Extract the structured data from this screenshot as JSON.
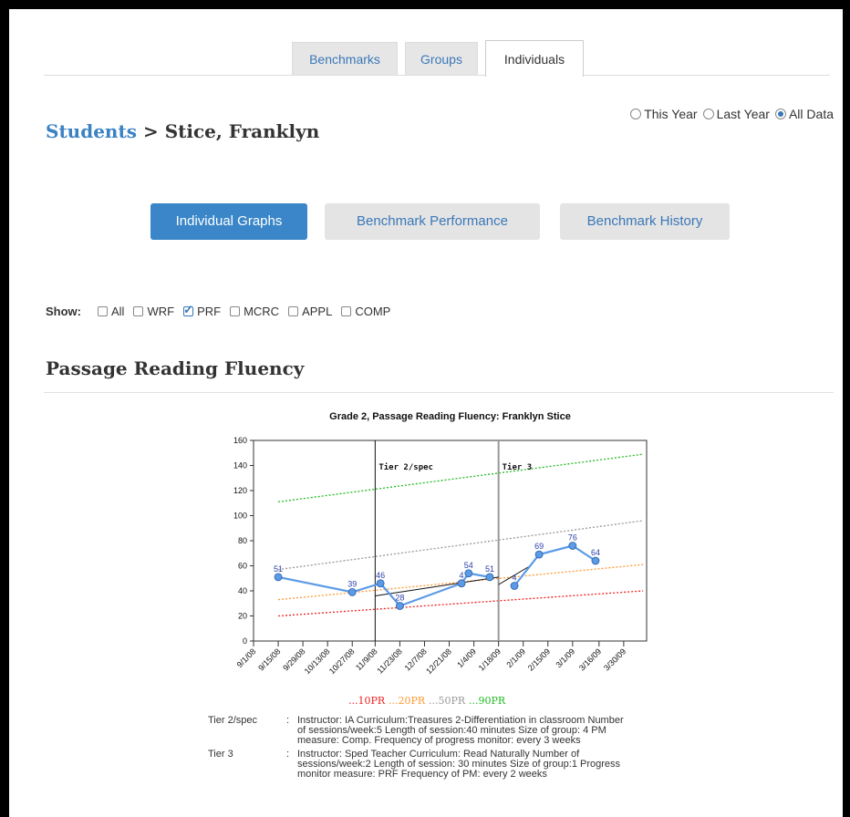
{
  "tabs": [
    {
      "label": "Benchmarks",
      "active": false
    },
    {
      "label": "Groups",
      "active": false
    },
    {
      "label": "Individuals",
      "active": true
    }
  ],
  "filters": {
    "this_year": "This Year",
    "last_year": "Last Year",
    "all_data": "All Data",
    "selected": "all_data"
  },
  "breadcrumb": {
    "parent": "Students",
    "separator": ">",
    "current": "Stice, Franklyn"
  },
  "view_buttons": [
    {
      "label": "Individual Graphs",
      "active": true
    },
    {
      "label": "Benchmark Performance",
      "active": false
    },
    {
      "label": "Benchmark History",
      "active": false
    }
  ],
  "show": {
    "label": "Show:",
    "options": [
      {
        "label": "All",
        "checked": false
      },
      {
        "label": "WRF",
        "checked": false
      },
      {
        "label": "PRF",
        "checked": true
      },
      {
        "label": "MCRC",
        "checked": false
      },
      {
        "label": "APPL",
        "checked": false
      },
      {
        "label": "COMP",
        "checked": false
      }
    ]
  },
  "section_title": "Passage Reading Fluency",
  "colors": {
    "accent": "#3a86c8",
    "link": "#3b82c4",
    "series": "#5b9be6",
    "pr10": "#ee2222",
    "pr20": "#ff9933",
    "pr50": "#999999",
    "pr90": "#22bb22"
  },
  "chart_data": {
    "type": "line",
    "title": "Grade 2, Passage Reading Fluency: Franklyn Stice",
    "x_ticks": [
      "9/1/08",
      "9/15/08",
      "9/29/08",
      "10/13/08",
      "10/27/08",
      "11/9/08",
      "11/23/08",
      "12/7/08",
      "12/21/08",
      "1/4/09",
      "1/18/09",
      "2/1/09",
      "2/15/09",
      "3/1/09",
      "3/16/09",
      "3/30/09"
    ],
    "ylim": [
      0,
      160
    ],
    "y_ticks": [
      0,
      20,
      40,
      60,
      80,
      100,
      120,
      140,
      160
    ],
    "series": [
      {
        "points": [
          {
            "x": "2008-09-15",
            "y": 51
          },
          {
            "x": "2008-10-27",
            "y": 39
          },
          {
            "x": "2008-11-12",
            "y": 46
          },
          {
            "x": "2008-11-23",
            "y": 28
          },
          {
            "x": "2008-12-28",
            "y": 46
          },
          {
            "x": "2009-01-01",
            "y": 54
          },
          {
            "x": "2009-01-13",
            "y": 51
          },
          {
            "x": "2009-01-27",
            "y": 44
          },
          {
            "x": "2009-02-10",
            "y": 69
          },
          {
            "x": "2009-03-01",
            "y": 76
          },
          {
            "x": "2009-03-14",
            "y": 64
          }
        ]
      }
    ],
    "point_labels": [
      "51",
      "39",
      "46",
      "28",
      "4",
      "54",
      "51",
      "4",
      "69",
      "76",
      "64"
    ],
    "benchmarks": [
      {
        "label": "10PR",
        "start": {
          "x": "2008-09-15",
          "y": 20
        },
        "end": {
          "x": "2009-04-10",
          "y": 40
        }
      },
      {
        "label": "20PR",
        "start": {
          "x": "2008-09-15",
          "y": 33
        },
        "end": {
          "x": "2009-04-10",
          "y": 61
        }
      },
      {
        "label": "50PR",
        "start": {
          "x": "2008-09-15",
          "y": 57
        },
        "end": {
          "x": "2009-04-10",
          "y": 96
        }
      },
      {
        "label": "90PR",
        "start": {
          "x": "2008-09-15",
          "y": 111
        },
        "end": {
          "x": "2009-04-10",
          "y": 149
        }
      }
    ],
    "legend_prefix": "...",
    "phases": [
      {
        "label": "Tier 2/spec",
        "x": "2008-11-09"
      },
      {
        "label": "Tier 3",
        "x": "2009-01-18"
      }
    ],
    "trend_lines": [
      {
        "start": {
          "x": "2008-11-09",
          "y": 36
        },
        "end": {
          "x": "2009-01-18",
          "y": 51
        }
      },
      {
        "start": {
          "x": "2009-01-18",
          "y": 45
        },
        "end": {
          "x": "2009-02-05",
          "y": 60
        }
      }
    ]
  },
  "notes": [
    {
      "label": "Tier 2/spec",
      "sep": ":",
      "text": "Instructor: IA Curriculum:Treasures 2-Differentiation in classroom Number of sessions/week:5 Length of session:40 minutes Size of group: 4 PM measure: Comp. Frequency of progress monitor: every 3 weeks"
    },
    {
      "label": "Tier 3",
      "sep": ":",
      "text": "Instructor: Sped Teacher Curriculum: Read Naturally Number of sessions/week:2 Length of session: 30 minutes Size of group:1 Progress monitor measure: PRF Frequency of PM: every 2 weeks"
    }
  ]
}
